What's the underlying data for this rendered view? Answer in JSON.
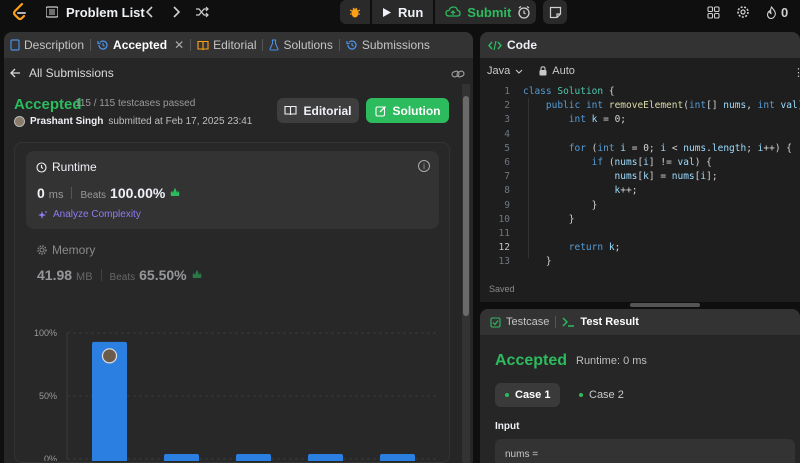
{
  "topbar": {
    "problem_list_label": "Problem List",
    "run_label": "Run",
    "submit_label": "Submit",
    "streak_count": "0"
  },
  "left_tabs": [
    {
      "label": "Description"
    },
    {
      "label": "Accepted"
    },
    {
      "label": "Editorial"
    },
    {
      "label": "Solutions"
    },
    {
      "label": "Submissions"
    }
  ],
  "submission": {
    "back_label": "All Submissions",
    "status": "Accepted",
    "testcases": "115 / 115 testcases passed",
    "author": "Prashant Singh",
    "submitted_text": "submitted at Feb 17, 2025 23:41",
    "editorial_button": "Editorial",
    "solution_button": "Solution"
  },
  "runtime": {
    "title": "Runtime",
    "value": "0",
    "unit": "ms",
    "beats_label": "Beats",
    "beats_value": "100.00%",
    "analyze_label": "Analyze Complexity"
  },
  "memory": {
    "title": "Memory",
    "value": "41.98",
    "unit": "MB",
    "beats_label": "Beats",
    "beats_value": "65.50%"
  },
  "chart_data": {
    "type": "bar",
    "ytick_labels": [
      "100%",
      "50%",
      "0%"
    ],
    "ylim": [
      0,
      100
    ],
    "values": [
      93,
      4,
      4,
      4,
      4
    ],
    "highlight_color": "#2b7fe0"
  },
  "code": {
    "header": "Code",
    "language": "Java",
    "mode": "Auto",
    "saved_label": "Saved",
    "lines": [
      {
        "n": "1",
        "html": "<span class='kw'>class</span> <span class='cl'>Solution</span> {"
      },
      {
        "n": "2",
        "html": "    <span class='kw'>public</span> <span class='kw'>int</span> <span class='fn'>removeElement</span>(<span class='kw'>int</span>[] <span class='vr'>nums</span>, <span class='kw'>int</span> <span class='vr'>val</span>) {"
      },
      {
        "n": "3",
        "html": "        <span class='kw'>int</span> <span class='vr'>k</span> = 0;"
      },
      {
        "n": "4",
        "html": ""
      },
      {
        "n": "5",
        "html": "        <span class='kw'>for</span> (<span class='kw'>int</span> <span class='vr'>i</span> = 0; <span class='vr'>i</span> &lt; <span class='vr'>nums</span>.<span class='vr'>length</span>; <span class='vr'>i</span>++) {"
      },
      {
        "n": "6",
        "html": "            <span class='kw'>if</span> (<span class='vr'>nums</span>[<span class='vr'>i</span>] != <span class='vr'>val</span>) {"
      },
      {
        "n": "7",
        "html": "                <span class='vr'>nums</span>[<span class='vr'>k</span>] = <span class='vr'>nums</span>[<span class='vr'>i</span>];"
      },
      {
        "n": "8",
        "html": "                <span class='vr'>k</span>++;"
      },
      {
        "n": "9",
        "html": "            }"
      },
      {
        "n": "10",
        "html": "        }"
      },
      {
        "n": "11",
        "html": ""
      },
      {
        "n": "12",
        "html": "        <span class='kw'>return</span> <span class='vr'>k</span>;"
      },
      {
        "n": "13",
        "html": "    }"
      }
    ]
  },
  "test": {
    "testcase_tab": "Testcase",
    "result_tab": "Test Result",
    "status": "Accepted",
    "runtime": "Runtime: 0 ms",
    "case1": "Case 1",
    "case2": "Case 2",
    "input_label": "Input",
    "input_value": "nums ="
  }
}
